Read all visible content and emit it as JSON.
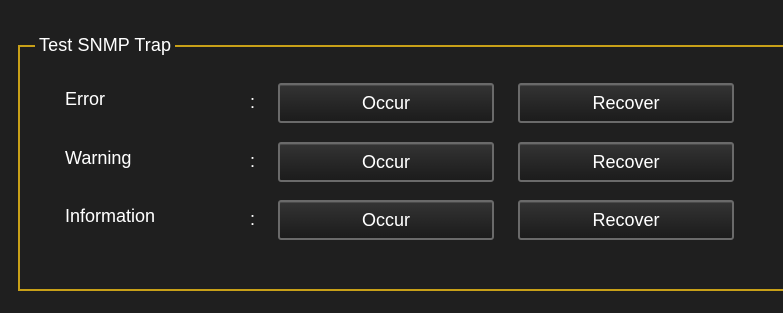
{
  "panel": {
    "title": "Test SNMP Trap"
  },
  "separator": ":",
  "rows": [
    {
      "label": "Error",
      "occur_label": "Occur",
      "recover_label": "Recover"
    },
    {
      "label": "Warning",
      "occur_label": "Occur",
      "recover_label": "Recover"
    },
    {
      "label": "Information",
      "occur_label": "Occur",
      "recover_label": "Recover"
    }
  ],
  "colors": {
    "background": "#1f1f1f",
    "border_accent": "#c8a018",
    "text": "#ffffff",
    "button_border": "#6a6a6a"
  }
}
